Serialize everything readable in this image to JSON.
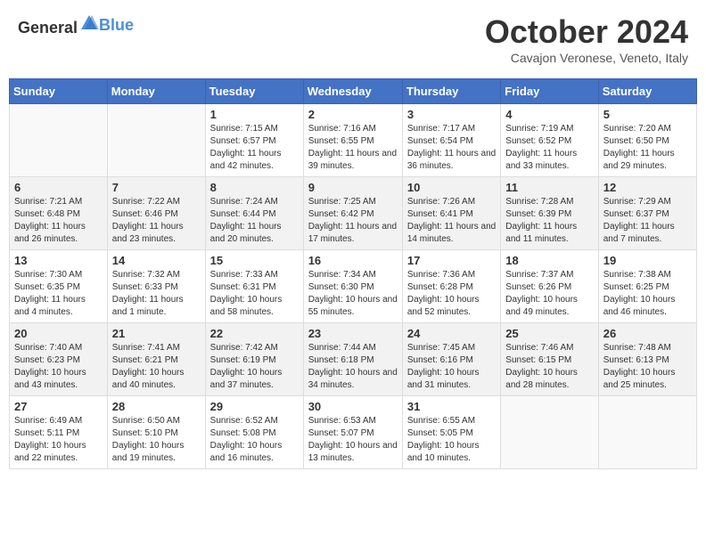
{
  "header": {
    "logo_general": "General",
    "logo_blue": "Blue",
    "month_title": "October 2024",
    "subtitle": "Cavajon Veronese, Veneto, Italy"
  },
  "days_of_week": [
    "Sunday",
    "Monday",
    "Tuesday",
    "Wednesday",
    "Thursday",
    "Friday",
    "Saturday"
  ],
  "weeks": [
    [
      {
        "day": "",
        "info": ""
      },
      {
        "day": "",
        "info": ""
      },
      {
        "day": "1",
        "info": "Sunrise: 7:15 AM\nSunset: 6:57 PM\nDaylight: 11 hours and 42 minutes."
      },
      {
        "day": "2",
        "info": "Sunrise: 7:16 AM\nSunset: 6:55 PM\nDaylight: 11 hours and 39 minutes."
      },
      {
        "day": "3",
        "info": "Sunrise: 7:17 AM\nSunset: 6:54 PM\nDaylight: 11 hours and 36 minutes."
      },
      {
        "day": "4",
        "info": "Sunrise: 7:19 AM\nSunset: 6:52 PM\nDaylight: 11 hours and 33 minutes."
      },
      {
        "day": "5",
        "info": "Sunrise: 7:20 AM\nSunset: 6:50 PM\nDaylight: 11 hours and 29 minutes."
      }
    ],
    [
      {
        "day": "6",
        "info": "Sunrise: 7:21 AM\nSunset: 6:48 PM\nDaylight: 11 hours and 26 minutes."
      },
      {
        "day": "7",
        "info": "Sunrise: 7:22 AM\nSunset: 6:46 PM\nDaylight: 11 hours and 23 minutes."
      },
      {
        "day": "8",
        "info": "Sunrise: 7:24 AM\nSunset: 6:44 PM\nDaylight: 11 hours and 20 minutes."
      },
      {
        "day": "9",
        "info": "Sunrise: 7:25 AM\nSunset: 6:42 PM\nDaylight: 11 hours and 17 minutes."
      },
      {
        "day": "10",
        "info": "Sunrise: 7:26 AM\nSunset: 6:41 PM\nDaylight: 11 hours and 14 minutes."
      },
      {
        "day": "11",
        "info": "Sunrise: 7:28 AM\nSunset: 6:39 PM\nDaylight: 11 hours and 11 minutes."
      },
      {
        "day": "12",
        "info": "Sunrise: 7:29 AM\nSunset: 6:37 PM\nDaylight: 11 hours and 7 minutes."
      }
    ],
    [
      {
        "day": "13",
        "info": "Sunrise: 7:30 AM\nSunset: 6:35 PM\nDaylight: 11 hours and 4 minutes."
      },
      {
        "day": "14",
        "info": "Sunrise: 7:32 AM\nSunset: 6:33 PM\nDaylight: 11 hours and 1 minute."
      },
      {
        "day": "15",
        "info": "Sunrise: 7:33 AM\nSunset: 6:31 PM\nDaylight: 10 hours and 58 minutes."
      },
      {
        "day": "16",
        "info": "Sunrise: 7:34 AM\nSunset: 6:30 PM\nDaylight: 10 hours and 55 minutes."
      },
      {
        "day": "17",
        "info": "Sunrise: 7:36 AM\nSunset: 6:28 PM\nDaylight: 10 hours and 52 minutes."
      },
      {
        "day": "18",
        "info": "Sunrise: 7:37 AM\nSunset: 6:26 PM\nDaylight: 10 hours and 49 minutes."
      },
      {
        "day": "19",
        "info": "Sunrise: 7:38 AM\nSunset: 6:25 PM\nDaylight: 10 hours and 46 minutes."
      }
    ],
    [
      {
        "day": "20",
        "info": "Sunrise: 7:40 AM\nSunset: 6:23 PM\nDaylight: 10 hours and 43 minutes."
      },
      {
        "day": "21",
        "info": "Sunrise: 7:41 AM\nSunset: 6:21 PM\nDaylight: 10 hours and 40 minutes."
      },
      {
        "day": "22",
        "info": "Sunrise: 7:42 AM\nSunset: 6:19 PM\nDaylight: 10 hours and 37 minutes."
      },
      {
        "day": "23",
        "info": "Sunrise: 7:44 AM\nSunset: 6:18 PM\nDaylight: 10 hours and 34 minutes."
      },
      {
        "day": "24",
        "info": "Sunrise: 7:45 AM\nSunset: 6:16 PM\nDaylight: 10 hours and 31 minutes."
      },
      {
        "day": "25",
        "info": "Sunrise: 7:46 AM\nSunset: 6:15 PM\nDaylight: 10 hours and 28 minutes."
      },
      {
        "day": "26",
        "info": "Sunrise: 7:48 AM\nSunset: 6:13 PM\nDaylight: 10 hours and 25 minutes."
      }
    ],
    [
      {
        "day": "27",
        "info": "Sunrise: 6:49 AM\nSunset: 5:11 PM\nDaylight: 10 hours and 22 minutes."
      },
      {
        "day": "28",
        "info": "Sunrise: 6:50 AM\nSunset: 5:10 PM\nDaylight: 10 hours and 19 minutes."
      },
      {
        "day": "29",
        "info": "Sunrise: 6:52 AM\nSunset: 5:08 PM\nDaylight: 10 hours and 16 minutes."
      },
      {
        "day": "30",
        "info": "Sunrise: 6:53 AM\nSunset: 5:07 PM\nDaylight: 10 hours and 13 minutes."
      },
      {
        "day": "31",
        "info": "Sunrise: 6:55 AM\nSunset: 5:05 PM\nDaylight: 10 hours and 10 minutes."
      },
      {
        "day": "",
        "info": ""
      },
      {
        "day": "",
        "info": ""
      }
    ]
  ]
}
